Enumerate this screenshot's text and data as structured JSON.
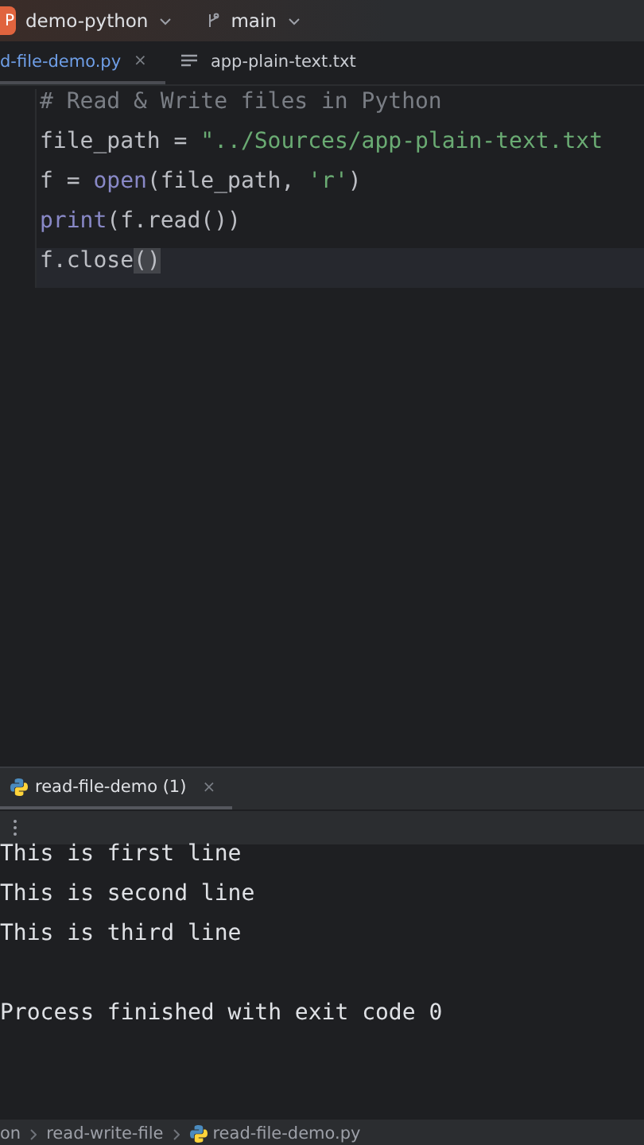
{
  "titlebar": {
    "project_initial": "P",
    "project": "demo-python",
    "branch": "main"
  },
  "editor_tabs": [
    {
      "label": "d-file-demo.py",
      "kind": "python",
      "selected": true,
      "close": "×"
    },
    {
      "label": "app-plain-text.txt",
      "kind": "text",
      "selected": false
    }
  ],
  "code_lines": [
    {
      "tokens": [
        {
          "text": "# Read & Write files in Python",
          "kind": "comment"
        }
      ]
    },
    {
      "tokens": [
        {
          "text": "file_path = ",
          "kind": "plain"
        },
        {
          "text": "\"../Sources/app-plain-text.txt",
          "kind": "string"
        }
      ]
    },
    {
      "tokens": [
        {
          "text": "f = ",
          "kind": "plain"
        },
        {
          "text": "open",
          "kind": "builtin"
        },
        {
          "text": "(file_path, ",
          "kind": "plain"
        },
        {
          "text": "'r'",
          "kind": "string"
        },
        {
          "text": ")",
          "kind": "plain"
        }
      ]
    },
    {
      "tokens": [
        {
          "text": "print",
          "kind": "builtin"
        },
        {
          "text": "(f.read())",
          "kind": "plain"
        }
      ]
    },
    {
      "tokens": [
        {
          "text": "f.close",
          "kind": "plain"
        },
        {
          "text": "()",
          "kind": "matched"
        }
      ],
      "current": true
    }
  ],
  "run_panel": {
    "tab": {
      "label": "read-file-demo (1)",
      "selected": true,
      "close": "×"
    },
    "output": [
      {
        "text": "This is first line",
        "kind": "stdout"
      },
      {
        "text": "This is second line",
        "kind": "stdout"
      },
      {
        "text": "This is third line",
        "kind": "stdout"
      },
      {
        "text": "Process finished with exit code 0",
        "kind": "exit"
      }
    ]
  },
  "breadcrumbs": [
    {
      "label": "on"
    },
    {
      "label": "read-write-file"
    },
    {
      "label": "read-file-demo.py",
      "kind": "python"
    }
  ]
}
